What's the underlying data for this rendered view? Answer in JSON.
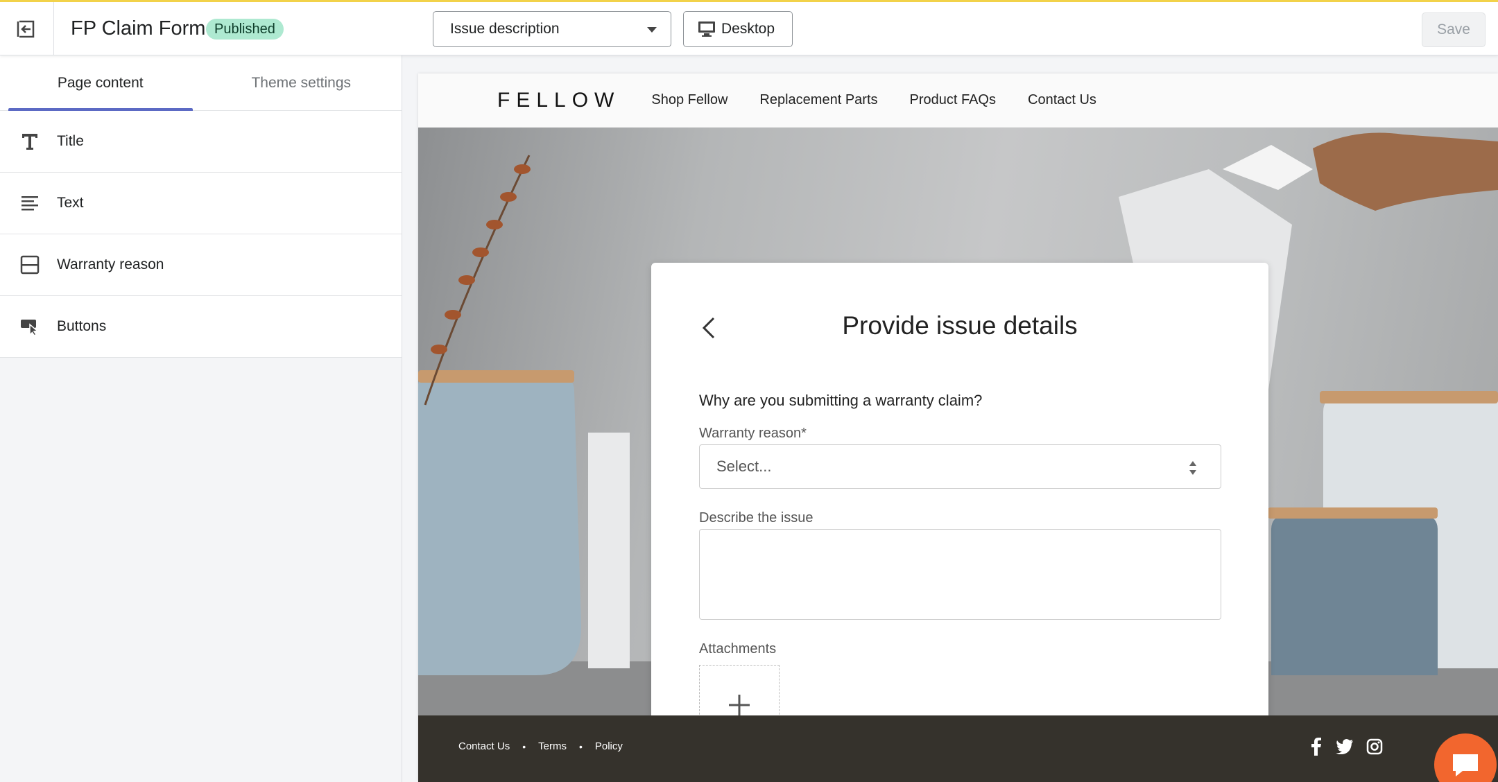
{
  "topbar": {
    "title": "FP Claim Form",
    "status": "Published",
    "page_selector": "Issue description",
    "device": "Desktop",
    "save_label": "Save"
  },
  "sidebar": {
    "tabs": [
      {
        "label": "Page content",
        "active": true
      },
      {
        "label": "Theme settings",
        "active": false
      }
    ],
    "items": [
      {
        "label": "Title",
        "icon": "title-icon"
      },
      {
        "label": "Text",
        "icon": "text-lines-icon"
      },
      {
        "label": "Warranty reason",
        "icon": "section-icon"
      },
      {
        "label": "Buttons",
        "icon": "button-cursor-icon"
      }
    ]
  },
  "preview": {
    "brand": "FELLOW",
    "nav": [
      "Shop Fellow",
      "Replacement Parts",
      "Product FAQs",
      "Contact Us"
    ],
    "card": {
      "title": "Provide issue details",
      "question": "Why are you submitting a warranty claim?",
      "warranty_label": "Warranty reason*",
      "select_placeholder": "Select...",
      "describe_label": "Describe the issue",
      "attachments_label": "Attachments"
    },
    "footer": {
      "links": [
        "Contact Us",
        "Terms",
        "Policy"
      ],
      "social": [
        "facebook-icon",
        "twitter-icon",
        "instagram-icon"
      ]
    }
  },
  "colors": {
    "accent": "#5c6ac4",
    "published_badge": "#aee9d1",
    "footer_bg": "#35322c",
    "chat": "#f2662e"
  }
}
